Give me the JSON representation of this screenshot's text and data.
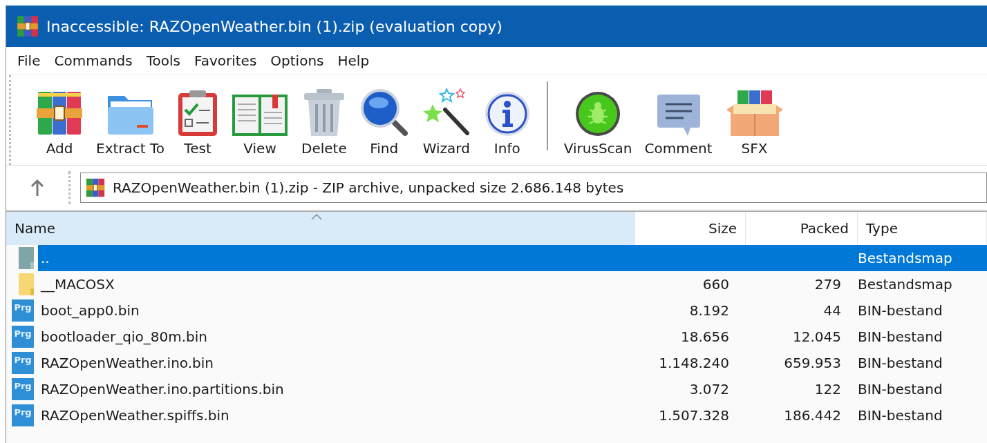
{
  "window": {
    "title": "Inaccessible: RAZOpenWeather.bin (1).zip (evaluation copy)"
  },
  "menu": [
    "File",
    "Commands",
    "Tools",
    "Favorites",
    "Options",
    "Help"
  ],
  "toolbar": [
    {
      "label": "Add",
      "kind": "add"
    },
    {
      "label": "Extract To",
      "kind": "extract"
    },
    {
      "label": "Test",
      "kind": "test"
    },
    {
      "label": "View",
      "kind": "view"
    },
    {
      "label": "Delete",
      "kind": "delete"
    },
    {
      "label": "Find",
      "kind": "find"
    },
    {
      "label": "Wizard",
      "kind": "wizard"
    },
    {
      "label": "Info",
      "kind": "info"
    },
    {
      "kind": "separator"
    },
    {
      "label": "VirusScan",
      "kind": "virusscan"
    },
    {
      "label": "Comment",
      "kind": "comment"
    },
    {
      "label": "SFX",
      "kind": "sfx"
    }
  ],
  "address": {
    "value": "RAZOpenWeather.bin (1).zip - ZIP archive, unpacked size 2.686.148 bytes"
  },
  "table": {
    "columns": [
      {
        "label": "Name",
        "sorted": true
      },
      {
        "label": "Size",
        "sorted": false
      },
      {
        "label": "Packed",
        "sorted": false
      },
      {
        "label": "Type",
        "sorted": false
      }
    ],
    "rows": [
      {
        "kind": "parent",
        "name": "..",
        "type": "Bestandsmap",
        "selected": true
      },
      {
        "kind": "folder",
        "name": "__MACOSX",
        "size": "660",
        "packed": "279",
        "type": "Bestandsmap",
        "selected": false
      },
      {
        "kind": "file",
        "icon_label": "Prg",
        "name": "boot_app0.bin",
        "size": "8.192",
        "packed": "44",
        "type": "BIN-bestand",
        "selected": false
      },
      {
        "kind": "file",
        "icon_label": "Prg",
        "name": "bootloader_qio_80m.bin",
        "size": "18.656",
        "packed": "12.045",
        "type": "BIN-bestand",
        "selected": false
      },
      {
        "kind": "file",
        "icon_label": "Prg",
        "name": "RAZOpenWeather.ino.bin",
        "size": "1.148.240",
        "packed": "659.953",
        "type": "BIN-bestand",
        "selected": false
      },
      {
        "kind": "file",
        "icon_label": "Prg",
        "name": "RAZOpenWeather.ino.partitions.bin",
        "size": "3.072",
        "packed": "122",
        "type": "BIN-bestand",
        "selected": false
      },
      {
        "kind": "file",
        "icon_label": "Prg",
        "name": "RAZOpenWeather.spiffs.bin",
        "size": "1.507.328",
        "packed": "186.442",
        "type": "BIN-bestand",
        "selected": false
      }
    ]
  }
}
